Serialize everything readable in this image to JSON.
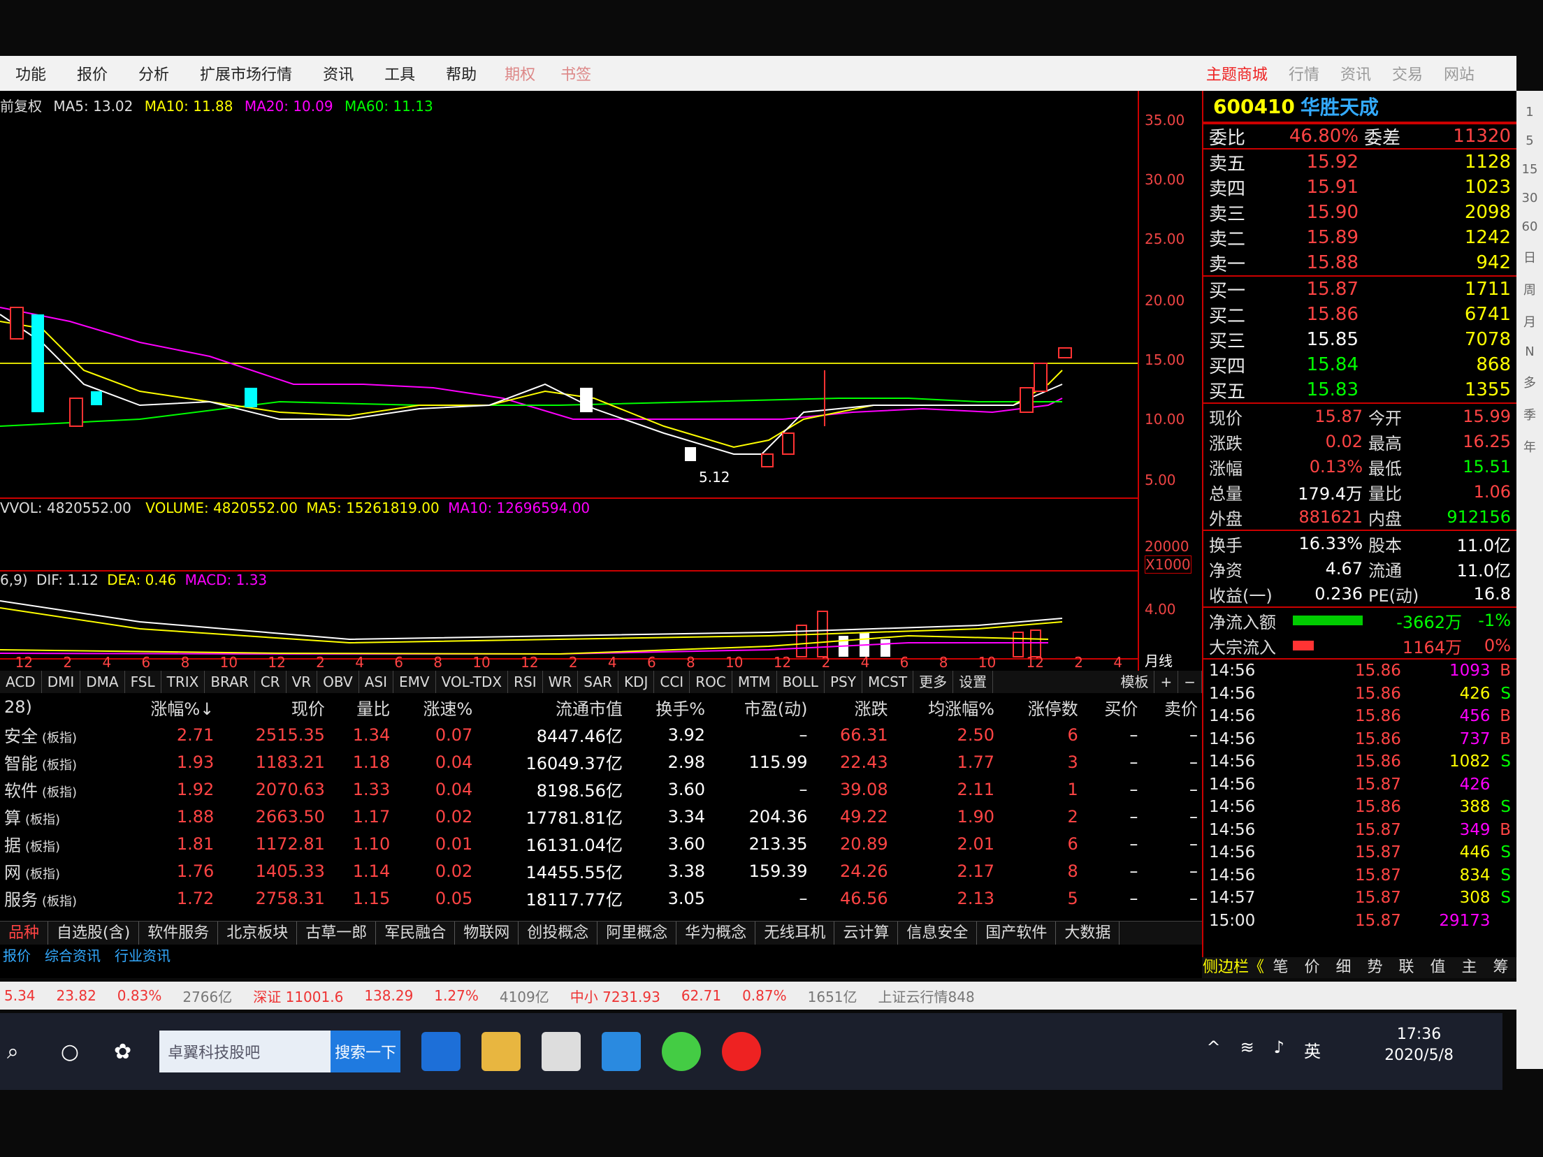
{
  "menu": {
    "items": [
      "功能",
      "报价",
      "分析",
      "扩展市场行情",
      "资讯",
      "工具",
      "帮助"
    ],
    "dim_items": [
      "期权",
      "书签"
    ],
    "right": [
      "主题商城",
      "行情",
      "资讯",
      "交易",
      "网站"
    ]
  },
  "chart": {
    "ma_label": "前复权",
    "ma5": "MA5: 13.02",
    "ma10": "MA10: 11.88",
    "ma20": "MA20: 10.09",
    "ma60": "MA60: 11.13",
    "yaxis": [
      "35.00",
      "30.00",
      "25.00",
      "20.00",
      "15.00",
      "10.00",
      "5.00"
    ],
    "low_mark": "5.12",
    "vol_line": "VVOL: 4820552.00",
    "volume": "VOLUME: 4820552.00",
    "vol_ma5": "MA5: 15261819.00",
    "vol_ma10": "MA10: 12696594.00",
    "vol_axis": "20000",
    "vol_unit": "X1000",
    "macd_prefix": "6,9)",
    "dif": "DIF: 1.12",
    "dea": "DEA: 0.46",
    "macd": "MACD: 1.33",
    "macd_axis": "4.00",
    "xlabels": [
      "12",
      "2",
      "4",
      "6",
      "8",
      "10",
      "12",
      "2",
      "4",
      "6",
      "8",
      "10",
      "12",
      "2",
      "4",
      "6",
      "8",
      "10",
      "12",
      "2",
      "4",
      "6",
      "8",
      "10",
      "12",
      "2",
      "4"
    ],
    "period": "月线"
  },
  "ind_tabs": [
    "ACD",
    "DMI",
    "DMA",
    "FSL",
    "TRIX",
    "BRAR",
    "CR",
    "VR",
    "OBV",
    "ASI",
    "EMV",
    "VOL-TDX",
    "RSI",
    "WR",
    "SAR",
    "KDJ",
    "CCI",
    "ROC",
    "MTM",
    "BOLL",
    "PSY",
    "MCST",
    "更多",
    "设置"
  ],
  "ind_right": [
    "模板",
    "+",
    "−"
  ],
  "table": {
    "headers": [
      "28)",
      "涨幅%↓",
      "现价",
      "量比",
      "涨速%",
      "流通市值",
      "换手%",
      "市盈(动)",
      "涨跌",
      "均涨幅%",
      "涨停数",
      "买价",
      "卖价"
    ],
    "rows": [
      {
        "name": "安全",
        "tag": "(板指)",
        "chg": "2.71",
        "price": "2515.35",
        "vr": "1.34",
        "spd": "0.07",
        "cap": "8447.46亿",
        "turn": "3.92",
        "pe": "–",
        "diff": "66.31",
        "avg": "2.50",
        "lim": "6",
        "bid": "–",
        "ask": "–"
      },
      {
        "name": "智能",
        "tag": "(板指)",
        "chg": "1.93",
        "price": "1183.21",
        "vr": "1.18",
        "spd": "0.04",
        "cap": "16049.37亿",
        "turn": "2.98",
        "pe": "115.99",
        "diff": "22.43",
        "avg": "1.77",
        "lim": "3",
        "bid": "–",
        "ask": "–"
      },
      {
        "name": "软件",
        "tag": "(板指)",
        "chg": "1.92",
        "price": "2070.63",
        "vr": "1.33",
        "spd": "0.04",
        "cap": "8198.56亿",
        "turn": "3.60",
        "pe": "–",
        "diff": "39.08",
        "avg": "2.11",
        "lim": "1",
        "bid": "–",
        "ask": "–"
      },
      {
        "name": "算",
        "tag": "(板指)",
        "chg": "1.88",
        "price": "2663.50",
        "vr": "1.17",
        "spd": "0.02",
        "cap": "17781.81亿",
        "turn": "3.34",
        "pe": "204.36",
        "diff": "49.22",
        "avg": "1.90",
        "lim": "2",
        "bid": "–",
        "ask": "–"
      },
      {
        "name": "据",
        "tag": "(板指)",
        "chg": "1.81",
        "price": "1172.81",
        "vr": "1.10",
        "spd": "0.01",
        "cap": "16131.04亿",
        "turn": "3.60",
        "pe": "213.35",
        "diff": "20.89",
        "avg": "2.01",
        "lim": "6",
        "bid": "–",
        "ask": "–"
      },
      {
        "name": "网",
        "tag": "(板指)",
        "chg": "1.76",
        "price": "1405.33",
        "vr": "1.14",
        "spd": "0.02",
        "cap": "14455.55亿",
        "turn": "3.38",
        "pe": "159.39",
        "diff": "24.26",
        "avg": "2.17",
        "lim": "8",
        "bid": "–",
        "ask": "–"
      },
      {
        "name": "服务",
        "tag": "(板指)",
        "chg": "1.72",
        "price": "2758.31",
        "vr": "1.15",
        "spd": "0.05",
        "cap": "18117.77亿",
        "turn": "3.05",
        "pe": "–",
        "diff": "46.56",
        "avg": "2.13",
        "lim": "5",
        "bid": "–",
        "ask": "–"
      }
    ]
  },
  "block_tabs": [
    "品种",
    "自选股(含)",
    "软件服务",
    "北京板块",
    "古草一郎",
    "军民融合",
    "物联网",
    "创投概念",
    "阿里概念",
    "华为概念",
    "无线耳机",
    "云计算",
    "信息安全",
    "国产软件",
    "大数据"
  ],
  "info_tabs": [
    "报价",
    "综合资讯",
    "行业资讯"
  ],
  "quote": {
    "code": "600410",
    "name": "华胜天成",
    "webi_label": "委比",
    "webi": "46.80%",
    "wecha_label": "委差",
    "wecha": "11320",
    "sells": [
      {
        "l": "卖五",
        "p": "15.92",
        "v": "1128"
      },
      {
        "l": "卖四",
        "p": "15.91",
        "v": "1023"
      },
      {
        "l": "卖三",
        "p": "15.90",
        "v": "2098"
      },
      {
        "l": "卖二",
        "p": "15.89",
        "v": "1242"
      },
      {
        "l": "卖一",
        "p": "15.88",
        "v": "942"
      }
    ],
    "buys": [
      {
        "l": "买一",
        "p": "15.87",
        "v": "1711"
      },
      {
        "l": "买二",
        "p": "15.86",
        "v": "6741"
      },
      {
        "l": "买三",
        "p": "15.85",
        "v": "7078"
      },
      {
        "l": "买四",
        "p": "15.84",
        "v": "868"
      },
      {
        "l": "买五",
        "p": "15.83",
        "v": "1355"
      }
    ],
    "stats": [
      {
        "a": "现价",
        "b": "15.87",
        "c": "今开",
        "d": "15.99"
      },
      {
        "a": "涨跌",
        "b": "0.02",
        "c": "最高",
        "d": "16.25"
      },
      {
        "a": "涨幅",
        "b": "0.13%",
        "c": "最低",
        "d": "15.51"
      },
      {
        "a": "总量",
        "b": "179.4万",
        "c": "量比",
        "d": "1.06"
      },
      {
        "a": "外盘",
        "b": "881621",
        "c": "内盘",
        "d": "912156"
      }
    ],
    "stats2": [
      {
        "a": "换手",
        "b": "16.33%",
        "c": "股本",
        "d": "11.0亿"
      },
      {
        "a": "净资",
        "b": "4.67",
        "c": "流通",
        "d": "11.0亿"
      },
      {
        "a": "收益(一)",
        "b": "0.236",
        "c": "PE(动)",
        "d": "16.8"
      }
    ],
    "flow": [
      {
        "a": "净流入额",
        "b": "-3662万",
        "c": "-1%"
      },
      {
        "a": "大宗流入",
        "b": "1164万",
        "c": "0%"
      }
    ],
    "ticks": [
      {
        "t": "14:56",
        "p": "15.86",
        "v": "1093",
        "s": "B"
      },
      {
        "t": "14:56",
        "p": "15.86",
        "v": "426",
        "s": "S"
      },
      {
        "t": "14:56",
        "p": "15.86",
        "v": "456",
        "s": "B"
      },
      {
        "t": "14:56",
        "p": "15.86",
        "v": "737",
        "s": "B"
      },
      {
        "t": "14:56",
        "p": "15.86",
        "v": "1082",
        "s": "S"
      },
      {
        "t": "14:56",
        "p": "15.87",
        "v": "426",
        "s": ""
      },
      {
        "t": "14:56",
        "p": "15.86",
        "v": "388",
        "s": "S"
      },
      {
        "t": "14:56",
        "p": "15.87",
        "v": "349",
        "s": "B"
      },
      {
        "t": "14:56",
        "p": "15.87",
        "v": "446",
        "s": "S"
      },
      {
        "t": "14:56",
        "p": "15.87",
        "v": "834",
        "s": "S"
      },
      {
        "t": "14:57",
        "p": "15.87",
        "v": "308",
        "s": "S"
      },
      {
        "t": "15:00",
        "p": "15.87",
        "v": "29173",
        "s": ""
      }
    ],
    "side_tabs": [
      "笔",
      "价",
      "细",
      "势",
      "联",
      "值",
      "主",
      "筹"
    ],
    "side_label": "侧边栏《"
  },
  "status": [
    "5.34",
    "23.82",
    "0.83%",
    "2766亿",
    "深证 11001.6",
    "138.29",
    "1.27%",
    "4109亿",
    "中小 7231.93",
    "62.71",
    "0.87%",
    "1651亿",
    "上证云行情848"
  ],
  "taskbar": {
    "search_text": "卓翼科技股吧",
    "search_btn": "搜索一下",
    "time": "17:36",
    "date": "2020/5/8",
    "ime": "英"
  },
  "right_strip": [
    "1",
    "5",
    "15",
    "30",
    "60",
    "日",
    "周",
    "月",
    "N",
    "多",
    "季",
    "年"
  ]
}
